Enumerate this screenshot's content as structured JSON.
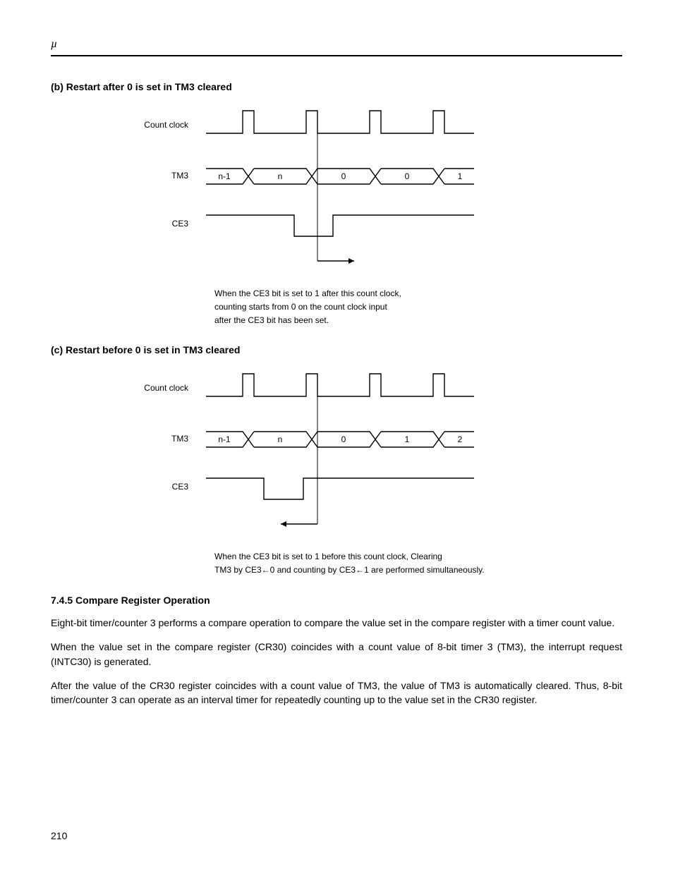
{
  "top_symbol": "µ",
  "sec_b": {
    "heading": "(b)  Restart after 0 is set in TM3 cleared",
    "labels": {
      "clock": "Count clock",
      "tm3": "TM3",
      "ce3": "CE3"
    },
    "tm3_values": [
      "n-1",
      "n",
      "0",
      "0",
      "1"
    ],
    "caption_l1": "When the CE3 bit is set to 1 after this count clock,",
    "caption_l2": "counting starts from 0 on the count clock input",
    "caption_l3": "after the CE3 bit has been set."
  },
  "sec_c": {
    "heading": "(c)  Restart before 0 is set in TM3 cleared",
    "labels": {
      "clock": "Count clock",
      "tm3": "TM3",
      "ce3": "CE3"
    },
    "tm3_values": [
      "n-1",
      "n",
      "0",
      "1",
      "2"
    ],
    "caption_l1": "When the CE3 bit is set to 1 before this count clock, Clearing",
    "caption_l2": "TM3 by CE3←0 and counting by CE3←1 are performed simultaneously."
  },
  "sec_745": {
    "heading": "7.4.5  Compare Register Operation",
    "p1": "Eight-bit timer/counter 3 performs a compare operation to compare the value set in the compare register with a timer count value.",
    "p2": "When the value set in the compare register (CR30) coincides with a count value of 8-bit timer 3 (TM3), the interrupt request (INTC30) is generated.",
    "p3": "After the value of the CR30 register coincides with a count value of TM3, the value of TM3 is automatically cleared. Thus, 8-bit timer/counter 3 can operate as an interval timer for repeatedly counting up to the value set in the CR30 register."
  },
  "page_number": "210"
}
